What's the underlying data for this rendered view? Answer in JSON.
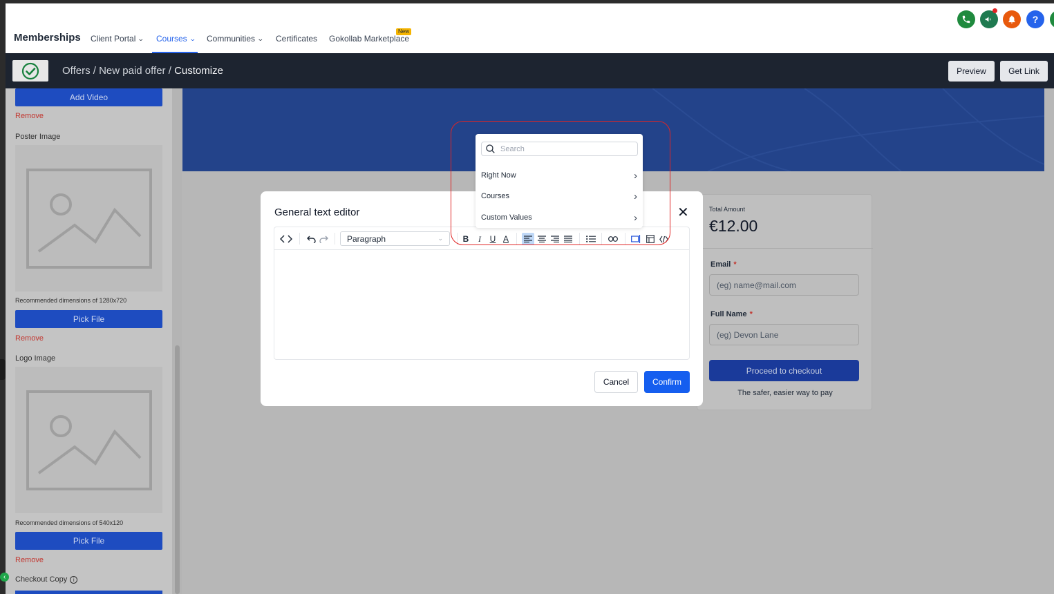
{
  "app": {
    "brand": "Memberships",
    "nav": [
      {
        "label": "Client Portal",
        "dropdown": true
      },
      {
        "label": "Courses",
        "dropdown": true,
        "active": true
      },
      {
        "label": "Communities",
        "dropdown": true
      },
      {
        "label": "Certificates",
        "dropdown": false
      },
      {
        "label": "Gokollab Marketplace",
        "dropdown": false,
        "badge": "New"
      }
    ],
    "top_icons": [
      {
        "name": "phone-icon",
        "color": "#1f8a3e"
      },
      {
        "name": "megaphone-icon",
        "color": "#1f7a50"
      },
      {
        "name": "bell-icon",
        "color": "#e8590c"
      },
      {
        "name": "help-icon",
        "color": "#2563eb",
        "glyph": "?"
      }
    ]
  },
  "subbar": {
    "breadcrumb": [
      "Offers",
      "New paid offer",
      "Customize"
    ],
    "separator": " / ",
    "preview_label": "Preview",
    "get_link_label": "Get Link"
  },
  "left_panel": {
    "add_video_label": "Add Video",
    "remove_label": "Remove",
    "poster_label": "Poster Image",
    "poster_rec": "Recommended dimensions of 1280x720",
    "pick_file_label": "Pick File",
    "logo_label": "Logo Image",
    "logo_rec": "Recommended dimensions of 540x120",
    "checkout_copy_label": "Checkout Copy"
  },
  "checkout": {
    "total_label": "Total Amount",
    "total_value": "€12.00",
    "email_label": "Email",
    "email_placeholder": "(eg) name@mail.com",
    "name_label": "Full Name",
    "name_placeholder": "(eg) Devon Lane",
    "required_mark": "*",
    "proceed_label": "Proceed to checkout",
    "safe_text": "The safer, easier way to pay"
  },
  "modal": {
    "title": "General text editor",
    "paragraph_value": "Paragraph",
    "cancel_label": "Cancel",
    "confirm_label": "Confirm"
  },
  "dropdown": {
    "search_placeholder": "Search",
    "items": [
      "Right Now",
      "Courses",
      "Custom Values"
    ]
  },
  "colors": {
    "accent": "#155eef",
    "highlight": "#e02424",
    "hero": "#23438a"
  }
}
